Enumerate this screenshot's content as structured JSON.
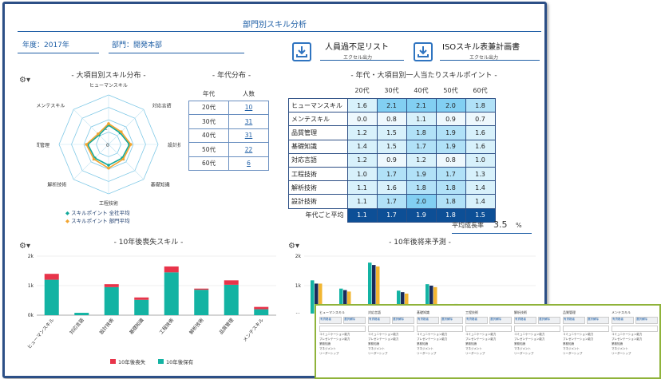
{
  "page": {
    "title": "部門別スキル分析"
  },
  "filters": {
    "year": "年度：2017年",
    "dept": "部門：開発本部"
  },
  "downloads": [
    {
      "title": "人員過不足リスト",
      "sub": "エクセル出力"
    },
    {
      "title": "ISOスキル表兼計画書",
      "sub": "エクセル出力"
    }
  ],
  "radar": {
    "title": "- 大項目別スキル分布 -",
    "axes": [
      "ヒューマンスキル",
      "対応言語",
      "設計技術",
      "基礎知識",
      "工程技術",
      "解析技術",
      "品質管理",
      "メンテスキル"
    ],
    "scale_labels": [
      "2",
      "0"
    ],
    "legend": [
      "スキルポイント 全社平均",
      "スキルポイント 部門平均"
    ],
    "company": [
      1.3,
      1.1,
      1.4,
      1.3,
      1.4,
      1.3,
      1.4,
      0.9
    ],
    "dept": [
      1.4,
      1.2,
      1.5,
      1.4,
      1.6,
      1.4,
      1.5,
      1.0
    ],
    "max": 6,
    "colors": {
      "company": "#12a89a",
      "dept": "#f2a531"
    }
  },
  "age_dist": {
    "title": "- 年代分布 -",
    "headers": [
      "年代",
      "人数"
    ],
    "rows": [
      {
        "age": "20代",
        "count": "10"
      },
      {
        "age": "30代",
        "count": "31"
      },
      {
        "age": "40代",
        "count": "31"
      },
      {
        "age": "50代",
        "count": "22"
      },
      {
        "age": "60代",
        "count": "6"
      }
    ]
  },
  "skill_table": {
    "title": "- 年代・大項目別一人当たりスキルポイント -",
    "cols": [
      "20代",
      "30代",
      "40代",
      "50代",
      "60代"
    ],
    "rows": [
      {
        "label": "ヒューマンスキル",
        "values": [
          "1.6",
          "2.1",
          "2.1",
          "2.0",
          "1.8"
        ]
      },
      {
        "label": "メンテスキル",
        "values": [
          "0.0",
          "0.8",
          "1.1",
          "0.9",
          "0.7"
        ]
      },
      {
        "label": "品質管理",
        "values": [
          "1.2",
          "1.5",
          "1.8",
          "1.9",
          "1.6"
        ]
      },
      {
        "label": "基礎知識",
        "values": [
          "1.4",
          "1.5",
          "1.7",
          "1.9",
          "1.6"
        ]
      },
      {
        "label": "対応言語",
        "values": [
          "1.2",
          "0.9",
          "1.2",
          "0.8",
          "1.0"
        ]
      },
      {
        "label": "工程技術",
        "values": [
          "1.0",
          "1.7",
          "1.9",
          "1.7",
          "1.3"
        ]
      },
      {
        "label": "解析技術",
        "values": [
          "1.1",
          "1.6",
          "1.8",
          "1.8",
          "1.4"
        ]
      },
      {
        "label": "設計技術",
        "values": [
          "1.1",
          "1.7",
          "2.0",
          "1.8",
          "1.4"
        ]
      }
    ],
    "avg_label": "年代ごと平均",
    "avg_values": [
      "1.1",
      "1.7",
      "1.9",
      "1.8",
      "1.5"
    ],
    "growth_label": "平均成長率",
    "growth_value": "3.5",
    "growth_unit": "%"
  },
  "chart_data": [
    {
      "type": "bar",
      "title": "- 10年後喪失スキル -",
      "categories": [
        "ヒューマンスキル",
        "対応言語",
        "設計技術",
        "基礎知識",
        "工程技術",
        "解析技術",
        "品質管理",
        "メンテスキル"
      ],
      "series": [
        {
          "name": "10年後喪失",
          "values": [
            200,
            0,
            100,
            80,
            200,
            40,
            150,
            80
          ],
          "color": "#e8344a"
        },
        {
          "name": "10年後保有",
          "values": [
            1200,
            80,
            950,
            520,
            1450,
            860,
            1030,
            200
          ],
          "color": "#13b3a3"
        }
      ],
      "ylim": [
        0,
        2000
      ],
      "yticks": [
        "0k",
        "1k",
        "2k"
      ]
    },
    {
      "type": "bar",
      "title": "- 10年後将来予測 -",
      "yticks": [
        "0k",
        "1k",
        "2k"
      ],
      "ylim": [
        0,
        2000
      ],
      "visible_groups": [
        [
          1180,
          1070,
          1070
        ],
        [
          900,
          850,
          800
        ],
        [
          1780,
          1700,
          1650
        ],
        [
          830,
          780,
          730
        ],
        [
          1050,
          1000,
          950
        ],
        [
          380,
          340,
          300
        ]
      ],
      "colors": [
        "#13b3a3",
        "#1a2a5a",
        "#f2b631"
      ]
    }
  ],
  "overlay": {
    "columns": [
      "ヒューマンスキル",
      "対応言語",
      "基礎知識",
      "工程技術",
      "解析技術",
      "品質管理",
      "メンテスキル"
    ],
    "btn_left": "有資格者",
    "btn_right": "選択解除",
    "items": [
      "コミュニケーション能力",
      "プレゼンテーション能力",
      "業務知識",
      "マネジメント",
      "リーダーシップ"
    ]
  }
}
